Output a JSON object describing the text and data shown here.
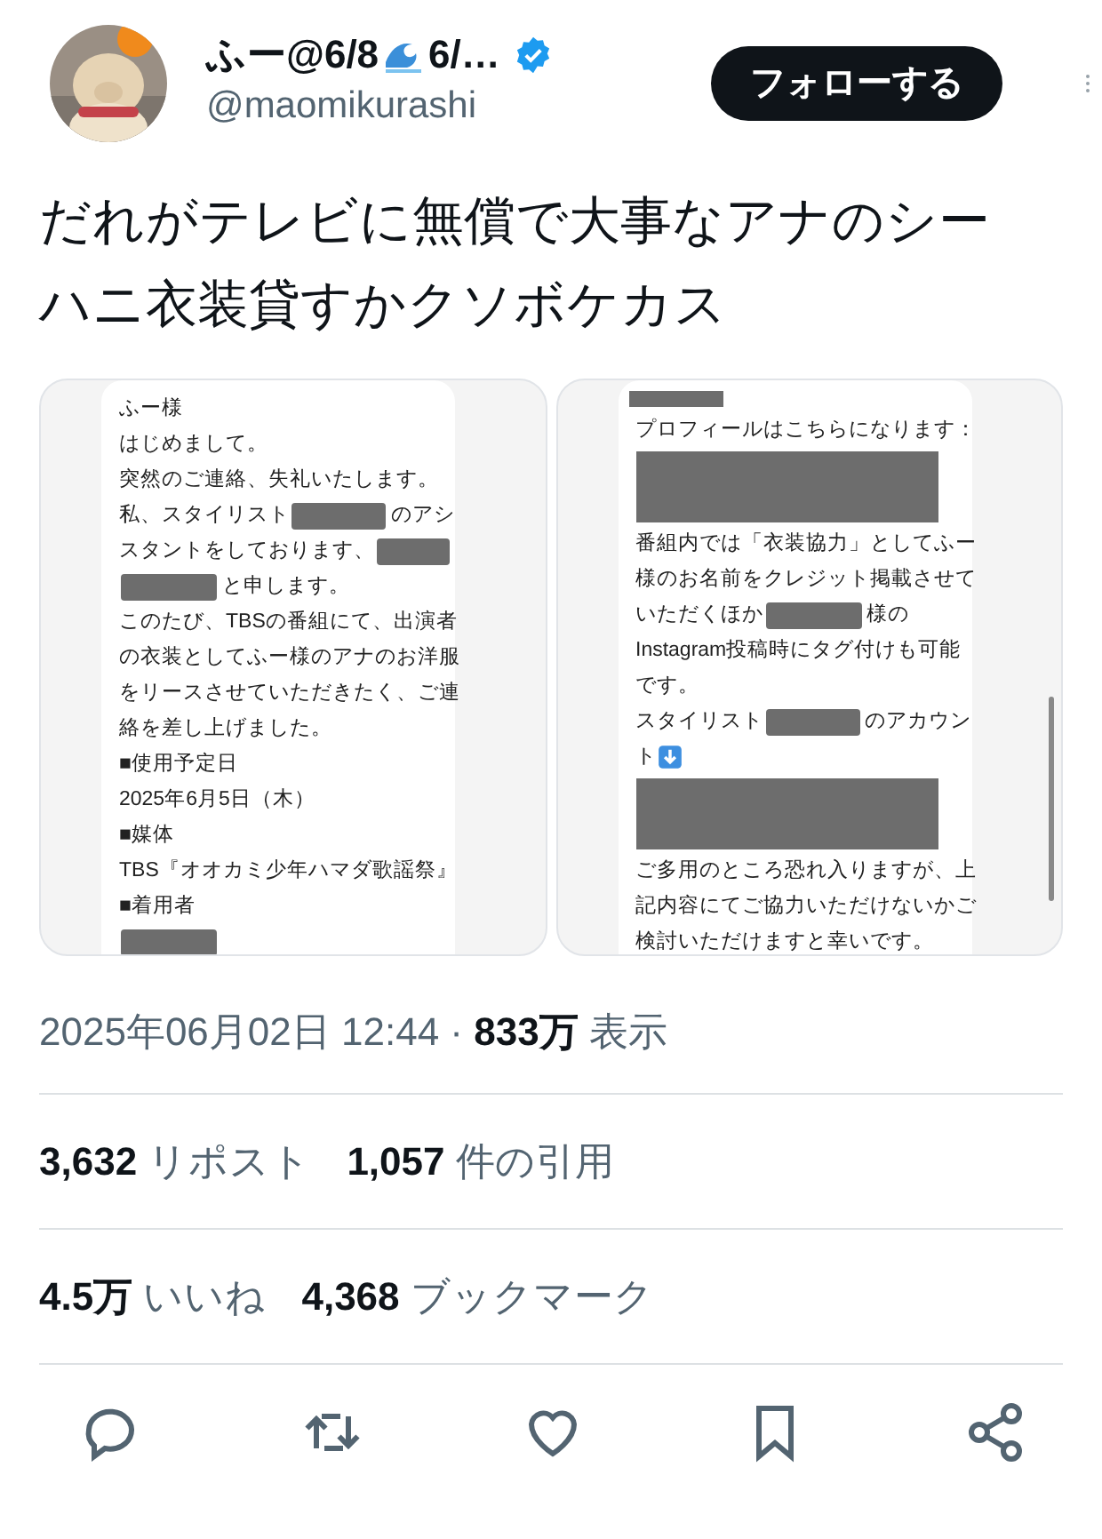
{
  "tweet": {
    "author": {
      "name_start": "ふー@6/8",
      "name_end": "6/…",
      "verified": true,
      "handle": "@maomikurashi"
    },
    "follow_button": "フォローする",
    "text": "だれがテレビに無償で大事なアナのシーハニ衣装貸すかクソボケカス",
    "media": [
      {
        "show_scrollbar": false,
        "lines": [
          [
            {
              "kind": "text",
              "text": "ふー様"
            }
          ],
          [
            {
              "kind": "text",
              "text": "はじめまして。"
            }
          ],
          [
            {
              "kind": "text",
              "text": "突然のご連絡、失礼いたします。"
            }
          ],
          [
            {
              "kind": "text",
              "text": "私、スタイリスト"
            },
            {
              "kind": "redaction"
            },
            {
              "kind": "text",
              "text": "のアシ"
            }
          ],
          [
            {
              "kind": "text",
              "text": "スタントをしております、"
            },
            {
              "kind": "redaction"
            }
          ],
          [
            {
              "kind": "redaction"
            },
            {
              "kind": "text",
              "text": "と申します。"
            }
          ],
          [
            {
              "kind": "text",
              "text": "このたび、TBSの番組にて、出演者"
            }
          ],
          [
            {
              "kind": "text",
              "text": "の衣装としてふー様のアナのお洋服"
            }
          ],
          [
            {
              "kind": "text",
              "text": "をリースさせていただきたく、ご連"
            }
          ],
          [
            {
              "kind": "text",
              "text": "絡を差し上げました。"
            }
          ],
          [
            {
              "kind": "text",
              "text": "■使用予定日"
            }
          ],
          [
            {
              "kind": "text",
              "text": "2025年6月5日（木）"
            }
          ],
          [
            {
              "kind": "text",
              "text": "■媒体"
            }
          ],
          [
            {
              "kind": "text",
              "text": "TBS『オオカミ少年ハマダ歌謡祭』"
            }
          ],
          [
            {
              "kind": "text",
              "text": "■着用者"
            }
          ],
          [
            {
              "kind": "redaction"
            }
          ]
        ]
      },
      {
        "show_scrollbar": true,
        "lines": [
          [
            {
              "kind": "cut_redaction"
            }
          ],
          [
            {
              "kind": "text",
              "text": "プロフィールはこちらになります："
            }
          ],
          [
            {
              "kind": "block_redaction"
            }
          ],
          [
            {
              "kind": "text",
              "text": "番組内では「衣装協力」としてふー"
            }
          ],
          [
            {
              "kind": "text",
              "text": "様のお名前をクレジット掲載させて"
            }
          ],
          [
            {
              "kind": "text",
              "text": "いただくほか"
            },
            {
              "kind": "redaction"
            },
            {
              "kind": "text",
              "text": "様の"
            }
          ],
          [
            {
              "kind": "text",
              "text": "Instagram投稿時にタグ付けも可能"
            }
          ],
          [
            {
              "kind": "text",
              "text": "です。"
            }
          ],
          [
            {
              "kind": "text",
              "text": "スタイリスト"
            },
            {
              "kind": "redaction"
            },
            {
              "kind": "text",
              "text": "のアカウン"
            }
          ],
          [
            {
              "kind": "text",
              "text": "ト"
            },
            {
              "kind": "down_arrow"
            }
          ],
          [
            {
              "kind": "block_redaction"
            }
          ],
          [
            {
              "kind": "text",
              "text": "ご多用のところ恐れ入りますが、上"
            }
          ],
          [
            {
              "kind": "text",
              "text": "記内容にてご協力いただけないかご"
            }
          ],
          [
            {
              "kind": "text",
              "text": "検討いただけますと幸いです。"
            }
          ]
        ]
      }
    ],
    "timestamp": "2025年06月02日 12:44",
    "separator": "·",
    "views_count": "833万",
    "views_label": "表示",
    "stats": [
      [
        {
          "count": "3,632",
          "label": "リポスト"
        },
        {
          "count": "1,057",
          "label": "件の引用"
        }
      ],
      [
        {
          "count": "4.5万",
          "label": "いいね"
        },
        {
          "count": "4,368",
          "label": "ブックマーク"
        }
      ]
    ],
    "actions": [
      {
        "kind": "reply"
      },
      {
        "kind": "repost"
      },
      {
        "kind": "like"
      },
      {
        "kind": "bookmark"
      },
      {
        "kind": "share"
      }
    ]
  }
}
